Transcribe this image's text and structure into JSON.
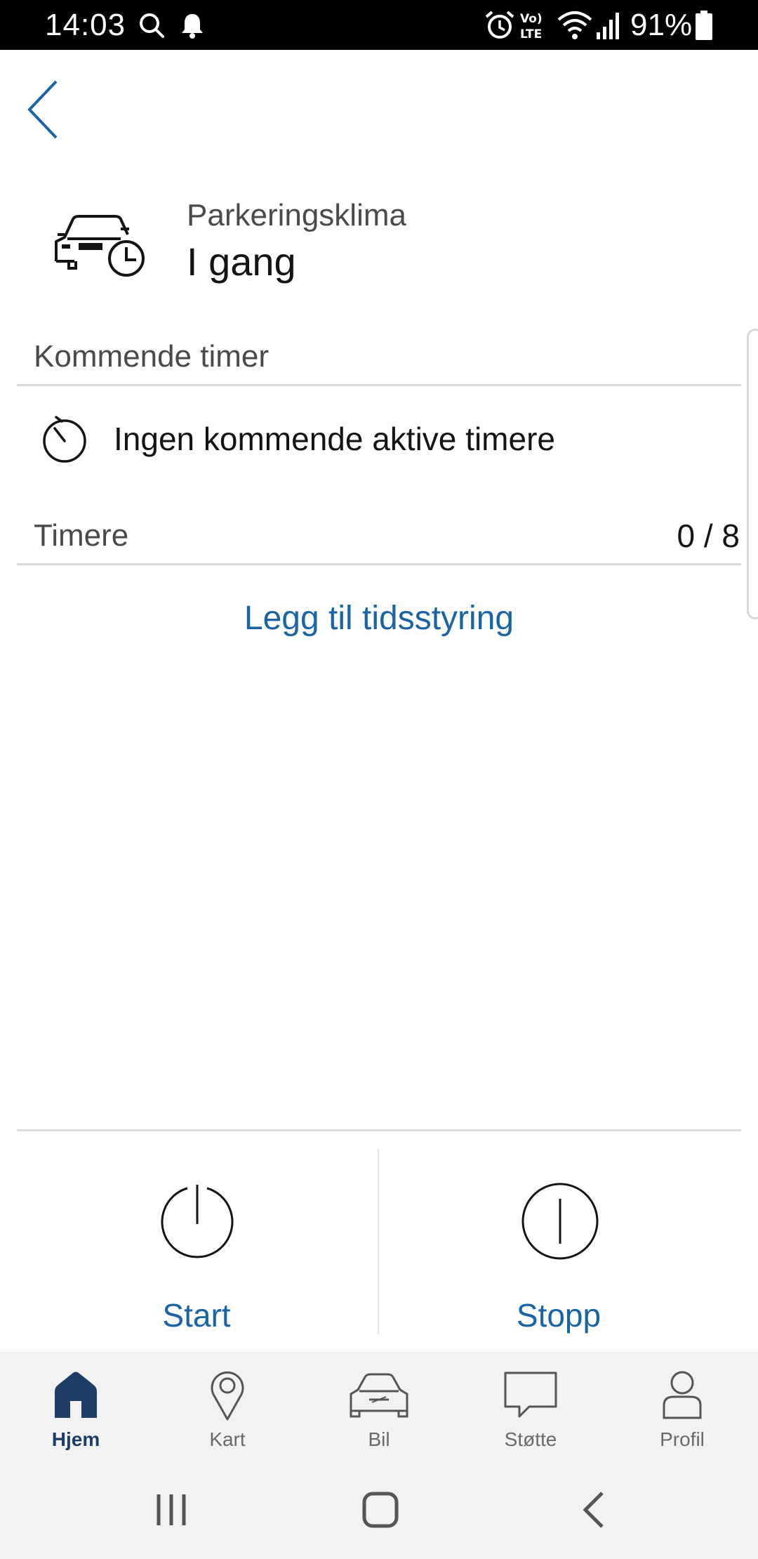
{
  "status_bar": {
    "time": "14:03",
    "battery": "91%",
    "icons": [
      "search-icon",
      "notification-bell-icon",
      "alarm-icon",
      "volte-icon",
      "wifi-icon",
      "signal-icon",
      "battery-icon"
    ]
  },
  "header": {
    "back_icon": "chevron-left-icon",
    "feature_icon": "car-clock-icon",
    "title": "Parkeringsklima",
    "status": "I gang"
  },
  "upcoming": {
    "label": "Kommende timer",
    "empty_icon": "stopwatch-icon",
    "empty_text": "Ingen kommende aktive timere"
  },
  "timers": {
    "label": "Timere",
    "count": "0 / 8",
    "add_link": "Legg til tidsstyring"
  },
  "actions": {
    "start": {
      "label": "Start",
      "icon": "power-on-icon"
    },
    "stop": {
      "label": "Stopp",
      "icon": "power-off-icon"
    }
  },
  "tabs": [
    {
      "label": "Hjem",
      "icon": "home-icon",
      "active": true
    },
    {
      "label": "Kart",
      "icon": "map-pin-icon",
      "active": false
    },
    {
      "label": "Bil",
      "icon": "car-icon",
      "active": false
    },
    {
      "label": "Støtte",
      "icon": "chat-bubble-icon",
      "active": false
    },
    {
      "label": "Profil",
      "icon": "profile-icon",
      "active": false
    }
  ],
  "colors": {
    "accent": "#1a64a6",
    "active_tab": "#1b3d66",
    "text": "#141414",
    "muted_text": "#4a4a4a",
    "tab_bar_bg": "#f2f2f2"
  }
}
